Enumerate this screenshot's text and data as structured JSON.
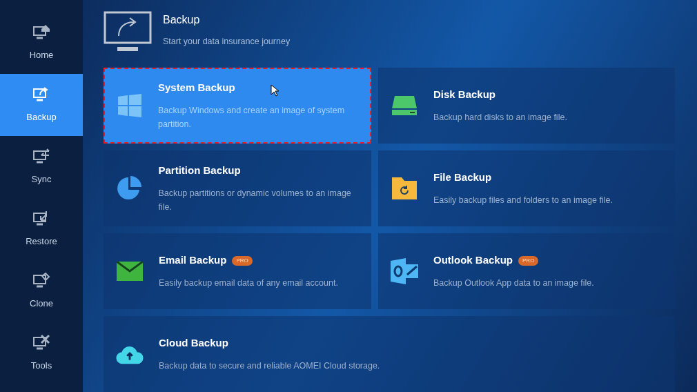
{
  "sidebar": {
    "items": [
      {
        "label": "Home",
        "kind": "home",
        "selected": false
      },
      {
        "label": "Backup",
        "kind": "backup",
        "selected": true
      },
      {
        "label": "Sync",
        "kind": "sync",
        "selected": false
      },
      {
        "label": "Restore",
        "kind": "restore",
        "selected": false
      },
      {
        "label": "Clone",
        "kind": "clone",
        "selected": false
      },
      {
        "label": "Tools",
        "kind": "tools",
        "selected": false
      }
    ]
  },
  "header": {
    "title": "Backup",
    "subtitle": "Start your data insurance journey"
  },
  "options": [
    {
      "kind": "system",
      "title": "System Backup",
      "description": "Backup Windows and create an image of system partition.",
      "selected": true
    },
    {
      "kind": "disk",
      "title": "Disk Backup",
      "description": "Backup hard disks to an image file.",
      "selected": false
    },
    {
      "kind": "partition",
      "title": "Partition Backup",
      "description": "Backup partitions or dynamic volumes to an image file.",
      "selected": false
    },
    {
      "kind": "file",
      "title": "File Backup",
      "description": "Easily backup files and folders to an image file.",
      "selected": false
    },
    {
      "kind": "email",
      "title": "Email Backup",
      "badge": "PRO",
      "description": "Easily backup email data of any email account.",
      "selected": false
    },
    {
      "kind": "outlook",
      "title": "Outlook Backup",
      "badge": "PRO",
      "description": "Backup Outlook App data to an image file.",
      "selected": false
    },
    {
      "kind": "cloud",
      "title": "Cloud Backup",
      "description": "Backup data to secure and reliable AOMEI Cloud storage.",
      "selected": false
    }
  ]
}
